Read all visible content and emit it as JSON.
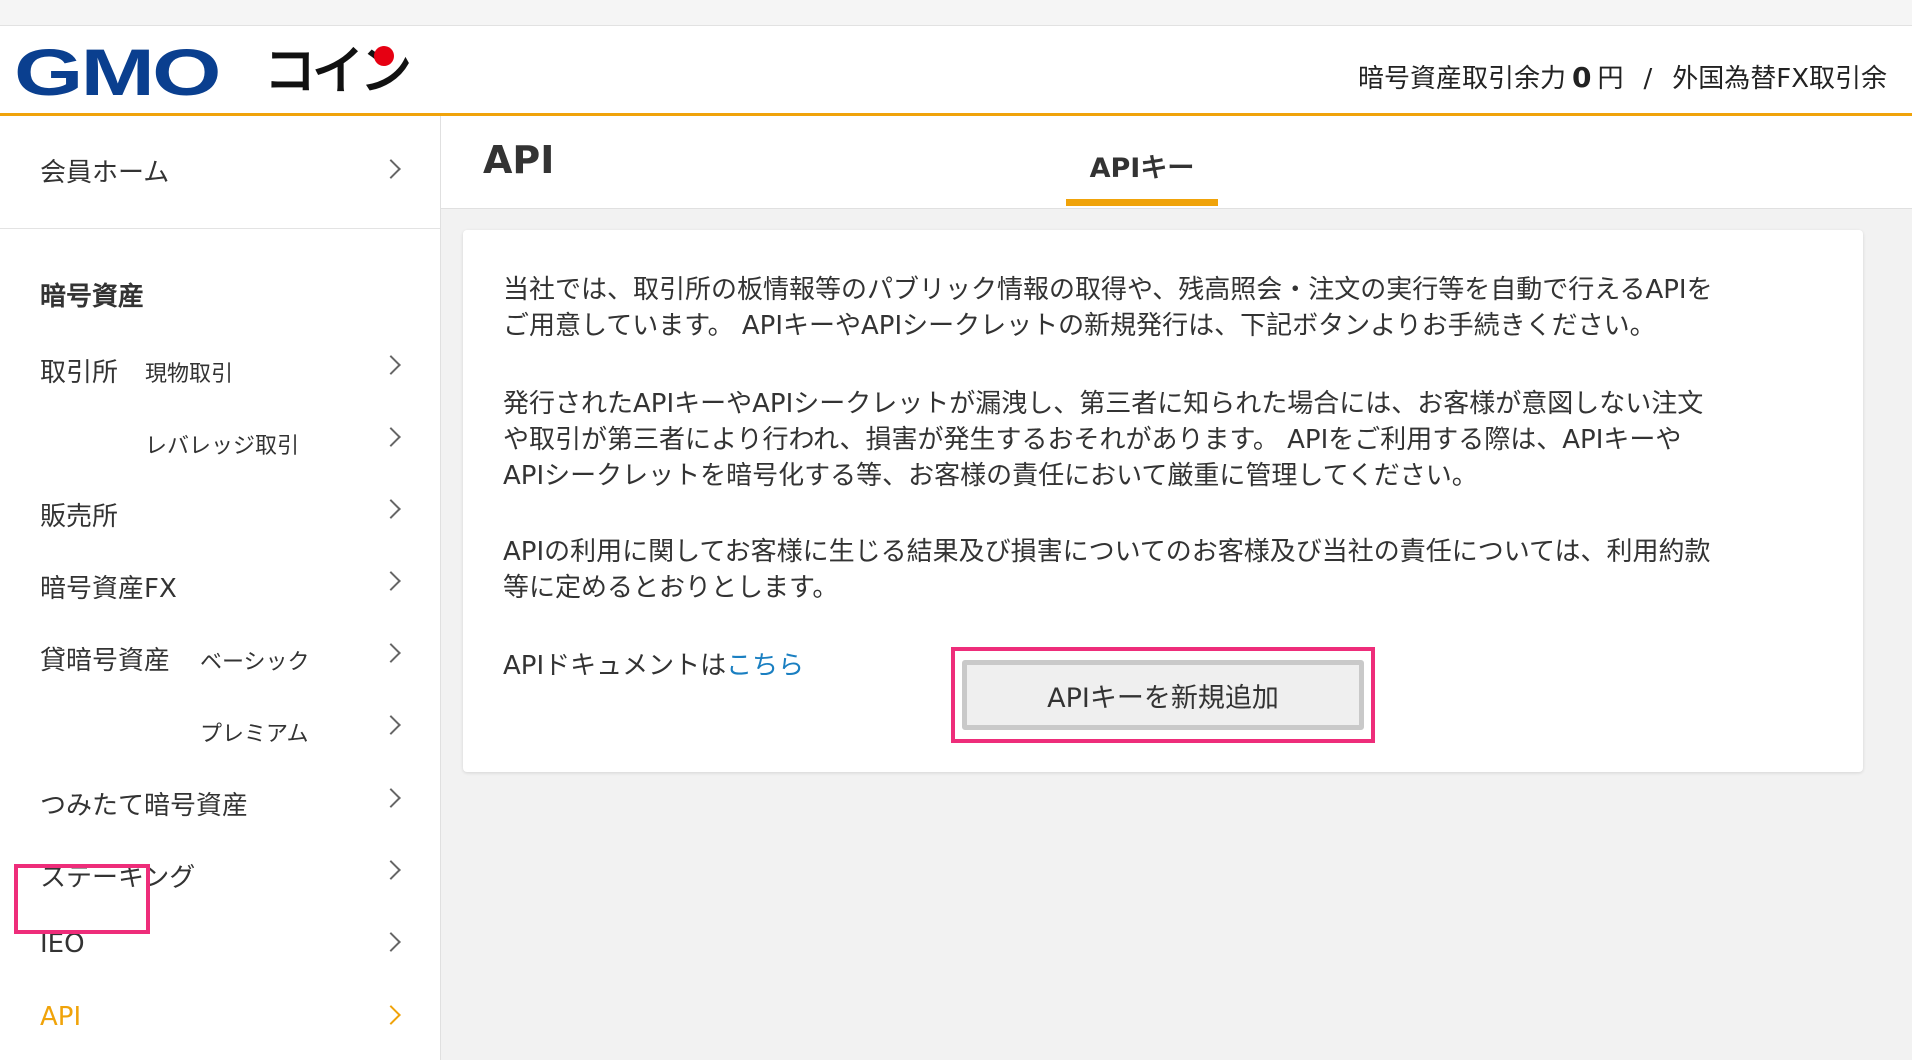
{
  "header": {
    "logo_alt": "GMOコイン",
    "logo_part1": "GMO",
    "logo_part2": "コイン",
    "balance_label": "暗号資産取引余力",
    "balance_amount": "0",
    "balance_unit": "円",
    "separator": "/",
    "fx_label": "外国為替FX取引余"
  },
  "sidebar": {
    "home": "会員ホーム",
    "section_title": "暗号資産",
    "items": [
      {
        "label": "取引所",
        "sub": "現物取引"
      },
      {
        "label": "",
        "sub": "レバレッジ取引"
      },
      {
        "label": "販売所",
        "sub": ""
      },
      {
        "label": "暗号資産FX",
        "sub": ""
      },
      {
        "label": "貸暗号資産",
        "sub": "ベーシック"
      },
      {
        "label": "",
        "sub": "プレミアム"
      },
      {
        "label": "つみたて暗号資産",
        "sub": ""
      },
      {
        "label": "ステーキング",
        "sub": ""
      },
      {
        "label": "IEO",
        "sub": ""
      },
      {
        "label": "API",
        "sub": ""
      }
    ],
    "active_item": "API"
  },
  "main": {
    "title": "API",
    "tab_label": "APIキー",
    "para1_line1": "当社では、取引所の板情報等のパブリック情報の取得や、残高照会・注文の実行等を自動で行えるAPIを",
    "para1_line2": "ご用意しています。 APIキーやAPIシークレットの新規発行は、下記ボタンよりお手続きください。",
    "para2_line1": "発行されたAPIキーやAPIシークレットが漏洩し、第三者に知られた場合には、お客様が意図しない注文",
    "para2_line2": "や取引が第三者により行われ、損害が発生するおそれがあります。 APIをご利用する際は、APIキーや",
    "para2_line3": "APIシークレットを暗号化する等、お客様の責任において厳重に管理してください。",
    "para3_line1": "APIの利用に関してお客様に生じる結果及び損害についてのお客様及び当社の責任については、利用約款",
    "para3_line2": "等に定めるとおりとします。",
    "doc_text": "APIドキュメントは",
    "doc_link": "こちら",
    "add_button": "APIキーを新規追加"
  },
  "colors": {
    "accent": "#f0a30a",
    "highlight": "#ee2d7a",
    "brand_blue": "#0a3f8f",
    "brand_red": "#e60012",
    "link": "#1a7fc1"
  }
}
